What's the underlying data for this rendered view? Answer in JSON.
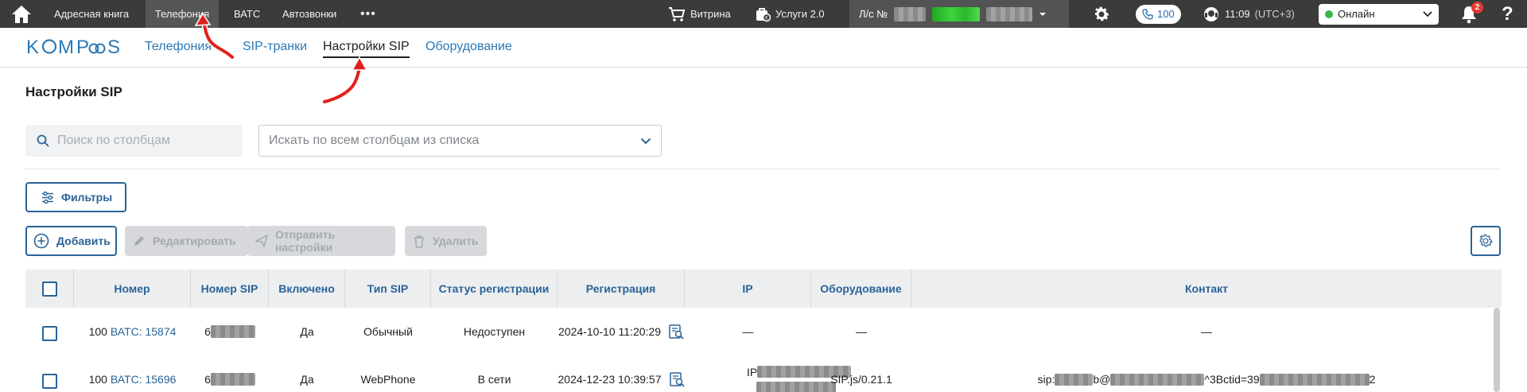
{
  "topbar": {
    "nav": [
      {
        "label": "Адресная книга",
        "active": false
      },
      {
        "label": "Телефония",
        "active": true
      },
      {
        "label": "ВАТС",
        "active": false
      },
      {
        "label": "Автозвонки",
        "active": false
      }
    ],
    "more_label": "•••",
    "showcase_label": "Витрина",
    "services_label": "Услуги 2.0",
    "account_prefix": "Л/с №",
    "line_count": "100",
    "time": "11:09",
    "timezone": "(UTC+3)",
    "status": "Онлайн",
    "notifications_count": "2",
    "help": "?"
  },
  "logo": {
    "text_before": "K",
    "text_o": "O",
    "text_mid": "MP",
    "text_end": "S",
    "full": "KOMPaS"
  },
  "subnav": [
    {
      "label": "Телефония",
      "active": false
    },
    {
      "label": "SIP-транки",
      "active": false
    },
    {
      "label": "Настройки SIP",
      "active": true
    },
    {
      "label": "Оборудование",
      "active": false
    }
  ],
  "page": {
    "title": "Настройки SIP"
  },
  "search": {
    "placeholder": "Поиск по столбцам",
    "value": ""
  },
  "column_select": {
    "placeholder": "Искать по всем столбцам из списка"
  },
  "buttons": {
    "filters": "Фильтры",
    "add": "Добавить",
    "edit": "Редактировать",
    "send": "Отправить настройки",
    "delete": "Удалить"
  },
  "table": {
    "columns": [
      "Номер",
      "Номер SIP",
      "Включено",
      "Тип SIP",
      "Статус регистрации",
      "Регистрация",
      "IP",
      "Оборудование",
      "Контакт"
    ],
    "rows": [
      {
        "number": "100",
        "vats": "ВАТС: 15874",
        "sip_number_prefix": "6",
        "enabled": "Да",
        "sip_type": "Обычный",
        "reg_status": "Недоступен",
        "registration": "2024-10-10 11:20:29",
        "ip": "—",
        "equipment": "—",
        "contact": "—"
      },
      {
        "number": "100",
        "vats": "ВАТС: 15696",
        "sip_number_prefix": "6",
        "enabled": "Да",
        "sip_type": "WebPhone",
        "reg_status": "В сети",
        "registration": "2024-12-23 10:39:57",
        "ip": "IP",
        "equipment": "SIP.js/0.21.1",
        "contact_start": "sip:",
        "contact_mid1": "b@",
        "contact_mid2": "^3Bctid=39",
        "contact_end": "2"
      }
    ]
  },
  "colors": {
    "accent": "#2a6398",
    "topbar": "#3b3b3b",
    "link": "#2b79b5",
    "online": "#3ab54a",
    "badge": "#e53935"
  }
}
